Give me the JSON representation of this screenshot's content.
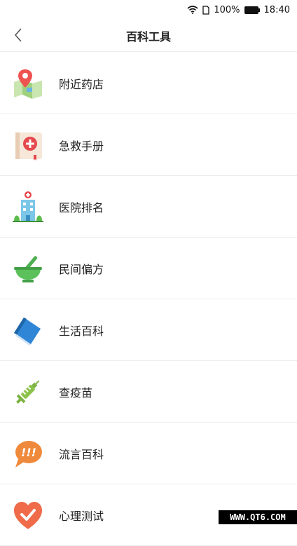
{
  "status_bar": {
    "wifi_icon": "wifi-icon",
    "sim_icon": "sim-icon",
    "battery_percent": "100%",
    "battery_icon": "battery-icon",
    "time": "18:40"
  },
  "header": {
    "back_icon": "chevron-left-icon",
    "title": "百科工具"
  },
  "items": [
    {
      "label": "附近药店",
      "icon": "map-pin-icon"
    },
    {
      "label": "急救手册",
      "icon": "first-aid-book-icon"
    },
    {
      "label": "医院排名",
      "icon": "hospital-icon"
    },
    {
      "label": "民间偏方",
      "icon": "mortar-pestle-icon"
    },
    {
      "label": "生活百科",
      "icon": "book-icon"
    },
    {
      "label": "查疫苗",
      "icon": "syringe-icon"
    },
    {
      "label": "流言百科",
      "icon": "speech-bubble-exclaim-icon"
    },
    {
      "label": "心理测试",
      "icon": "heart-check-icon"
    }
  ],
  "watermark": "WWW.QT6.COM"
}
